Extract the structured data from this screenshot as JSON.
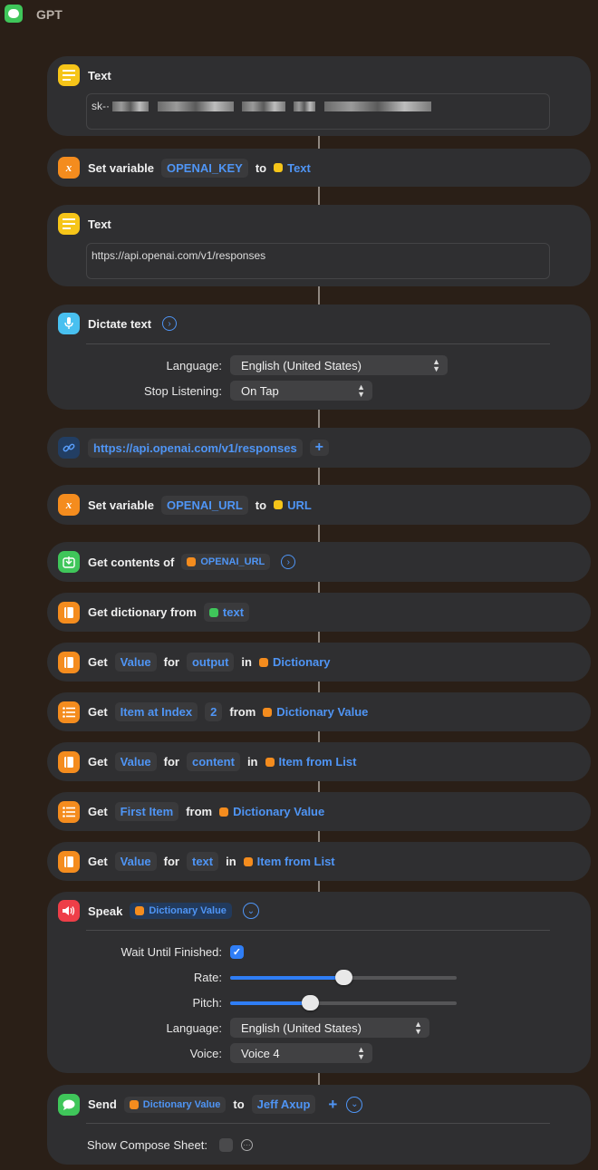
{
  "window": {
    "title": "GPT"
  },
  "actions": {
    "text1": {
      "label": "Text",
      "value": "sk-·"
    },
    "setvar1": {
      "label": "Set variable",
      "variable": "OPENAI_KEY",
      "to": "to",
      "value": "Text"
    },
    "text2": {
      "label": "Text",
      "value": "https://api.openai.com/v1/responses"
    },
    "dictate": {
      "label": "Dictate text",
      "language_label": "Language:",
      "language": "English (United States)",
      "stop_label": "Stop Listening:",
      "stop": "On Tap"
    },
    "url": {
      "value": "https://api.openai.com/v1/responses"
    },
    "setvar2": {
      "label": "Set variable",
      "variable": "OPENAI_URL",
      "to": "to",
      "value": "URL"
    },
    "getcontents": {
      "label": "Get contents of",
      "value": "OPENAI_URL"
    },
    "getdict": {
      "label": "Get dictionary from",
      "value": "text"
    },
    "getvalue1": {
      "get": "Get",
      "key_type": "Value",
      "for": "for",
      "key": "output",
      "in": "in",
      "source": "Dictionary"
    },
    "getitem1": {
      "get": "Get",
      "item": "Item at Index",
      "index": "2",
      "from": "from",
      "source": "Dictionary Value"
    },
    "getvalue2": {
      "get": "Get",
      "key_type": "Value",
      "for": "for",
      "key": "content",
      "in": "in",
      "source": "Item from List"
    },
    "getitem2": {
      "get": "Get",
      "item": "First Item",
      "from": "from",
      "source": "Dictionary Value"
    },
    "getvalue3": {
      "get": "Get",
      "key_type": "Value",
      "for": "for",
      "key": "text",
      "in": "in",
      "source": "Item from List"
    },
    "speak": {
      "label": "Speak",
      "value": "Dictionary Value",
      "wait_label": "Wait Until Finished:",
      "wait": true,
      "rate_label": "Rate:",
      "rate": 0.5,
      "pitch_label": "Pitch:",
      "pitch": 0.35,
      "language_label": "Language:",
      "language": "English (United States)",
      "voice_label": "Voice:",
      "voice": "Voice 4"
    },
    "send": {
      "label": "Send",
      "value": "Dictionary Value",
      "to": "to",
      "recipient": "Jeff Axup",
      "compose_label": "Show Compose Sheet:",
      "compose": false
    }
  },
  "icons": {
    "text": "text-lines-icon",
    "variable": "x-variable-icon",
    "dictate": "microphone-icon",
    "url": "link-icon",
    "contents": "download-icon",
    "dict": "book-icon",
    "list": "list-icon",
    "speak": "speaker-icon",
    "send": "message-bubble-icon"
  },
  "colors": {
    "background": "#2a1f17",
    "card": "#2f2f31",
    "accent": "#4f95f5",
    "slider": "#2f7ef6"
  }
}
